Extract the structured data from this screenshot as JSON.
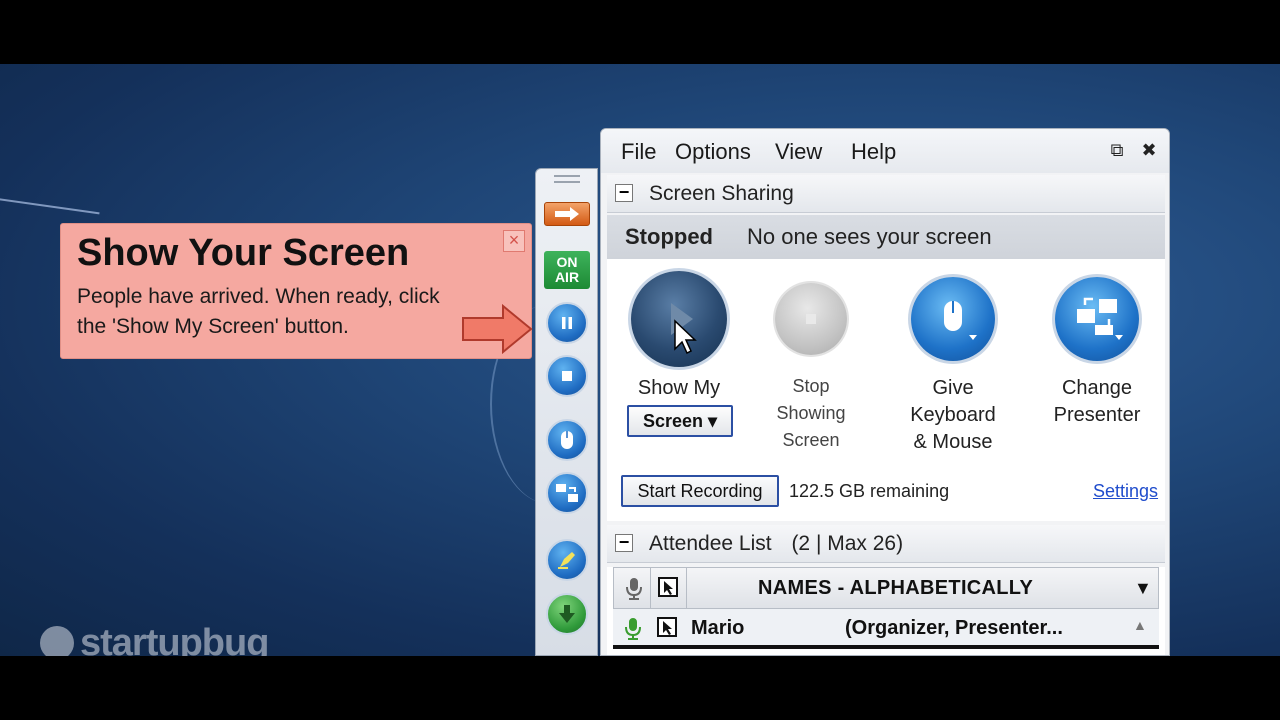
{
  "callout": {
    "title": "Show Your Screen",
    "body": "People have arrived. When ready, click the 'Show My Screen' button.",
    "close_glyph": "×"
  },
  "toolbar": {
    "on_air_line1": "ON",
    "on_air_line2": "AIR",
    "orange_button_icon": "arrow-right-icon",
    "buttons": [
      "pause-icon",
      "stop-icon",
      "mouse-icon",
      "change-presenter-icon",
      "highlighter-icon",
      "download-icon"
    ]
  },
  "menu": {
    "file": "File",
    "options": "Options",
    "view": "View",
    "help": "Help",
    "popout_glyph": "⧉",
    "close_glyph": "✖"
  },
  "screen_sharing": {
    "toggle": "−",
    "header": "Screen Sharing",
    "state": "Stopped",
    "message": "No one sees your screen",
    "show_my_line1": "Show My",
    "screen_dropdown": "Screen ▾",
    "stop_line1": "Stop",
    "stop_line2": "Showing",
    "stop_line3": "Screen",
    "give_line1": "Give",
    "give_line2": "Keyboard",
    "give_line3": "& Mouse",
    "change_line1": "Change",
    "change_line2": "Presenter"
  },
  "recording": {
    "button": "Start Recording",
    "remaining": "122.5 GB remaining",
    "settings": "Settings"
  },
  "attendees": {
    "toggle": "−",
    "header": "Attendee List",
    "count": "(2 | Max 26)",
    "column_names": "NAMES - ALPHABETICALLY",
    "sort_caret": "▼",
    "rows": [
      {
        "name": "Mario",
        "role": "(Organizer, Presenter..."
      }
    ],
    "scroll_up": "▲"
  },
  "watermark": "startupbug",
  "colors": {
    "callout_bg": "#f5a8a0",
    "on_air_green": "#1d8a34",
    "orb_blue": "#1f6cc2",
    "link_blue": "#1f4ccc"
  }
}
